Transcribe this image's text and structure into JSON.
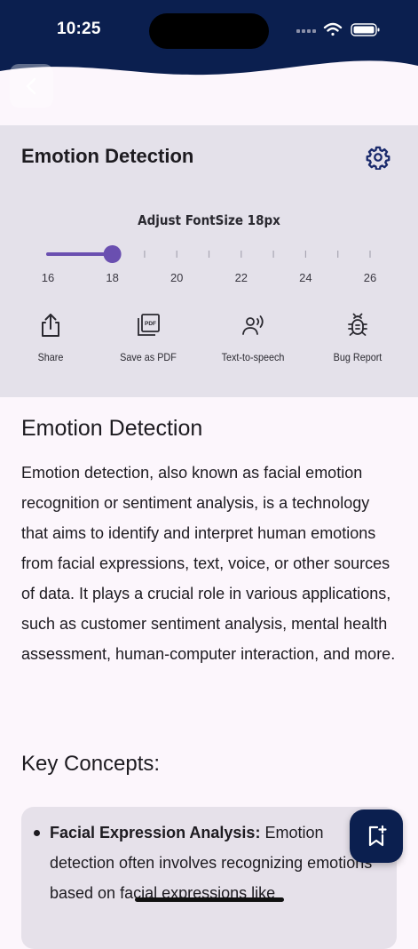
{
  "status_bar": {
    "time": "10:25"
  },
  "panel": {
    "title": "Emotion Detection",
    "font_label": "Adjust FontSize 18px",
    "slider": {
      "value": 18,
      "min": 16,
      "max": 26,
      "ticks": [
        "16",
        "18",
        "20",
        "22",
        "24",
        "26"
      ]
    },
    "actions": [
      {
        "label": "Share",
        "icon": "share-icon"
      },
      {
        "label": "Save as PDF",
        "icon": "pdf-icon"
      },
      {
        "label": "Text-to-speech",
        "icon": "speaker-icon"
      },
      {
        "label": "Bug Report",
        "icon": "bug-icon"
      }
    ]
  },
  "article": {
    "title": "Emotion Detection",
    "body": "Emotion detection, also known as facial emotion recognition or sentiment analysis, is a technology that aims to identify and interpret human emotions from facial expressions, text, voice, or other sources of data. It plays a crucial role in various applications, such as customer sentiment analysis, mental health assessment, human-computer interaction, and more.",
    "section_title": "Key Concepts:",
    "concepts": [
      {
        "term": "Facial Expression Analysis:",
        "text": "Emotion detection often involves recognizing emotions based on facial expressions like"
      }
    ]
  },
  "colors": {
    "navy": "#0b1f4f",
    "accent": "#6a4fb0",
    "panel_bg": "#e4e1ea",
    "page_bg": "#fcf6fc"
  }
}
